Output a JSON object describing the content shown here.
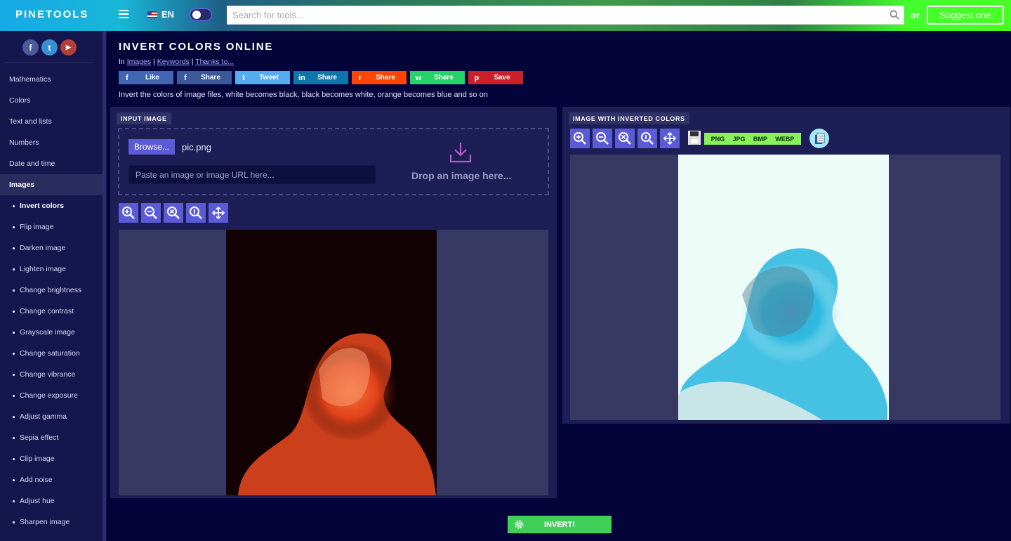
{
  "header": {
    "logo": "PINETOOLS",
    "language": "EN",
    "search_placeholder": "Search for tools...",
    "or_text": "or",
    "suggest_label": "Suggest one"
  },
  "sidebar": {
    "social": [
      "f",
      "t",
      "▶"
    ],
    "items": [
      {
        "label": "Mathematics"
      },
      {
        "label": "Colors"
      },
      {
        "label": "Text and lists"
      },
      {
        "label": "Numbers"
      },
      {
        "label": "Date and time"
      },
      {
        "label": "Images",
        "active": true
      }
    ],
    "subitems": [
      {
        "label": "Invert colors",
        "current": true
      },
      {
        "label": "Flip image"
      },
      {
        "label": "Darken image"
      },
      {
        "label": "Lighten image"
      },
      {
        "label": "Change brightness"
      },
      {
        "label": "Change contrast"
      },
      {
        "label": "Grayscale image"
      },
      {
        "label": "Change saturation"
      },
      {
        "label": "Change vibrance"
      },
      {
        "label": "Change exposure"
      },
      {
        "label": "Adjust gamma"
      },
      {
        "label": "Sepia effect"
      },
      {
        "label": "Clip image"
      },
      {
        "label": "Add noise"
      },
      {
        "label": "Adjust hue"
      },
      {
        "label": "Sharpen image"
      }
    ]
  },
  "page": {
    "title": "INVERT COLORS ONLINE",
    "breadcrumb_prefix": "In",
    "breadcrumb_links": [
      "Images",
      "Keywords",
      "Thanks to..."
    ],
    "description": "Invert the colors of image files, white becomes black, black becomes white, orange becomes blue and so on"
  },
  "share": [
    {
      "label": "Like",
      "icon": "f",
      "color": "#4267b2"
    },
    {
      "label": "Share",
      "icon": "f",
      "color": "#3b5998"
    },
    {
      "label": "Tweet",
      "icon": "t",
      "color": "#55acee"
    },
    {
      "label": "Share",
      "icon": "in",
      "color": "#0e76a8"
    },
    {
      "label": "Share",
      "icon": "r",
      "color": "#ff4500"
    },
    {
      "label": "Share",
      "icon": "w",
      "color": "#25d366"
    },
    {
      "label": "Save",
      "icon": "p",
      "color": "#cb2027"
    }
  ],
  "input_panel": {
    "label": "INPUT IMAGE",
    "browse_label": "Browse...",
    "filename": "pic.png",
    "url_placeholder": "Paste an image or image URL here...",
    "drop_text": "Drop an image here..."
  },
  "output_panel": {
    "label": "IMAGE WITH INVERTED COLORS",
    "formats": [
      "PNG",
      "JPG",
      "BMP",
      "WEBP"
    ]
  },
  "tools": [
    "zoom-in-icon",
    "zoom-out-icon",
    "zoom-reset-icon",
    "zoom-actual-icon",
    "move-icon"
  ],
  "invert_label": "INVERT!",
  "colors": {
    "accent": "#5b5bd8",
    "invert_button": "#3fcf58",
    "format_bar": "#89f25a"
  }
}
